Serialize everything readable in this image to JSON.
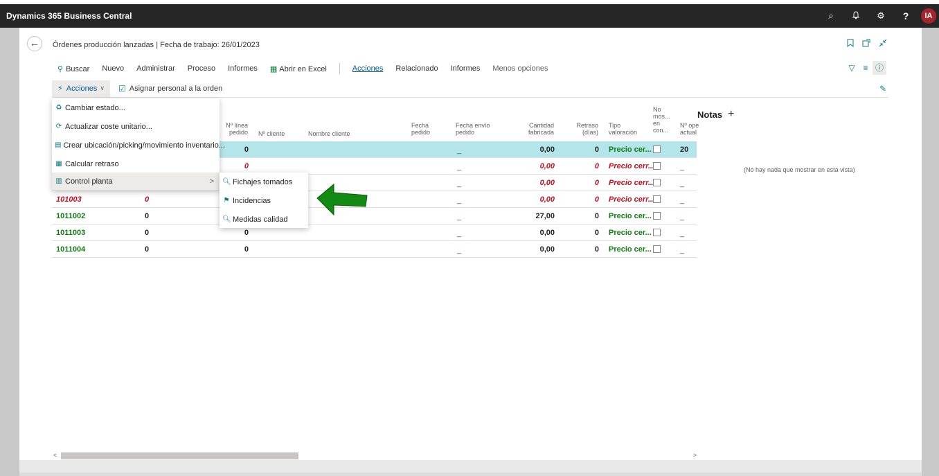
{
  "app": {
    "title": "Dynamics 365 Business Central",
    "user_initials": "IA"
  },
  "topbar_icons": [
    "search-icon",
    "bell-icon",
    "gear-icon",
    "help-icon"
  ],
  "header": {
    "title": "Órdenes producción lanzadas | Fecha de trabajo: 26/01/2023"
  },
  "actionbar": {
    "buscar": "Buscar",
    "items": [
      "Nuevo",
      "Administrar",
      "Proceso",
      "Informes"
    ],
    "excel": "Abrir en Excel",
    "tabs": [
      "Acciones",
      "Relacionado",
      "Informes"
    ],
    "menos": "Menos opciones"
  },
  "subbar": {
    "acciones": "Acciones",
    "asignar": "Asignar personal a la orden"
  },
  "columns": {
    "linea_pedido": [
      "Nº línea",
      "pedido"
    ],
    "cliente": "Nº cliente",
    "nombre_cliente": "Nombre cliente",
    "fecha_pedido": [
      "Fecha",
      "pedido"
    ],
    "fecha_envio": [
      "Fecha envío",
      "pedido"
    ],
    "cantidad": [
      "Cantidad",
      "fabricada"
    ],
    "retraso": [
      "Retraso",
      "(días)"
    ],
    "tipo": [
      "Tipo",
      "valoración"
    ],
    "no_mostrar": [
      "No",
      "mos...",
      "en",
      "con..."
    ],
    "n_ope": [
      "Nº ope",
      "actual"
    ]
  },
  "rows": [
    {
      "no": "",
      "col2": "",
      "linea": "0",
      "cantidad": "0,00",
      "retraso": "0",
      "tipo": "Precio cer...",
      "ope": "20",
      "style": "green",
      "selected": true
    },
    {
      "no": "",
      "col2": "",
      "linea": "0",
      "cantidad": "0,00",
      "retraso": "0",
      "tipo": "Precio cerr...",
      "ope": "_",
      "style": "red",
      "selected": false
    },
    {
      "no": "",
      "col2": "",
      "linea": "",
      "cantidad": "0,00",
      "retraso": "0",
      "tipo": "Precio cerr...",
      "ope": "_",
      "style": "red",
      "selected": false
    },
    {
      "no": "101003",
      "col2": "0",
      "linea": "",
      "cantidad": "0,00",
      "retraso": "0",
      "tipo": "Precio cerr...",
      "ope": "_",
      "style": "red",
      "selected": false
    },
    {
      "no": "1011002",
      "col2": "0",
      "linea": "",
      "cantidad": "27,00",
      "retraso": "0",
      "tipo": "Precio cer...",
      "ope": "_",
      "style": "green",
      "selected": false
    },
    {
      "no": "1011003",
      "col2": "0",
      "linea": "0",
      "cantidad": "0,00",
      "retraso": "0",
      "tipo": "Precio cer...",
      "ope": "_",
      "style": "green",
      "selected": false
    },
    {
      "no": "1011004",
      "col2": "0",
      "linea": "0",
      "cantidad": "0,00",
      "retraso": "0",
      "tipo": "Precio cer...",
      "ope": "_",
      "style": "green",
      "selected": false
    }
  ],
  "dash": "_",
  "notes": {
    "title": "Notas",
    "plus": "+",
    "empty": "(No hay nada que mostrar en esta vista)"
  },
  "menu": {
    "items": [
      "Cambiar estado...",
      "Actualizar coste unitario...",
      "Crear ubicación/picking/movimiento inventario...",
      "Calcular retraso",
      "Control planta"
    ],
    "submenu": [
      "Fichajes tomados",
      "Incidencias",
      "Medidas calidad"
    ]
  },
  "colors": {
    "accent": "#0e7a7f",
    "green": "#107c10",
    "red": "#c50f1f",
    "selected_row": "#b3e5ea",
    "arrow": "#138a13"
  }
}
